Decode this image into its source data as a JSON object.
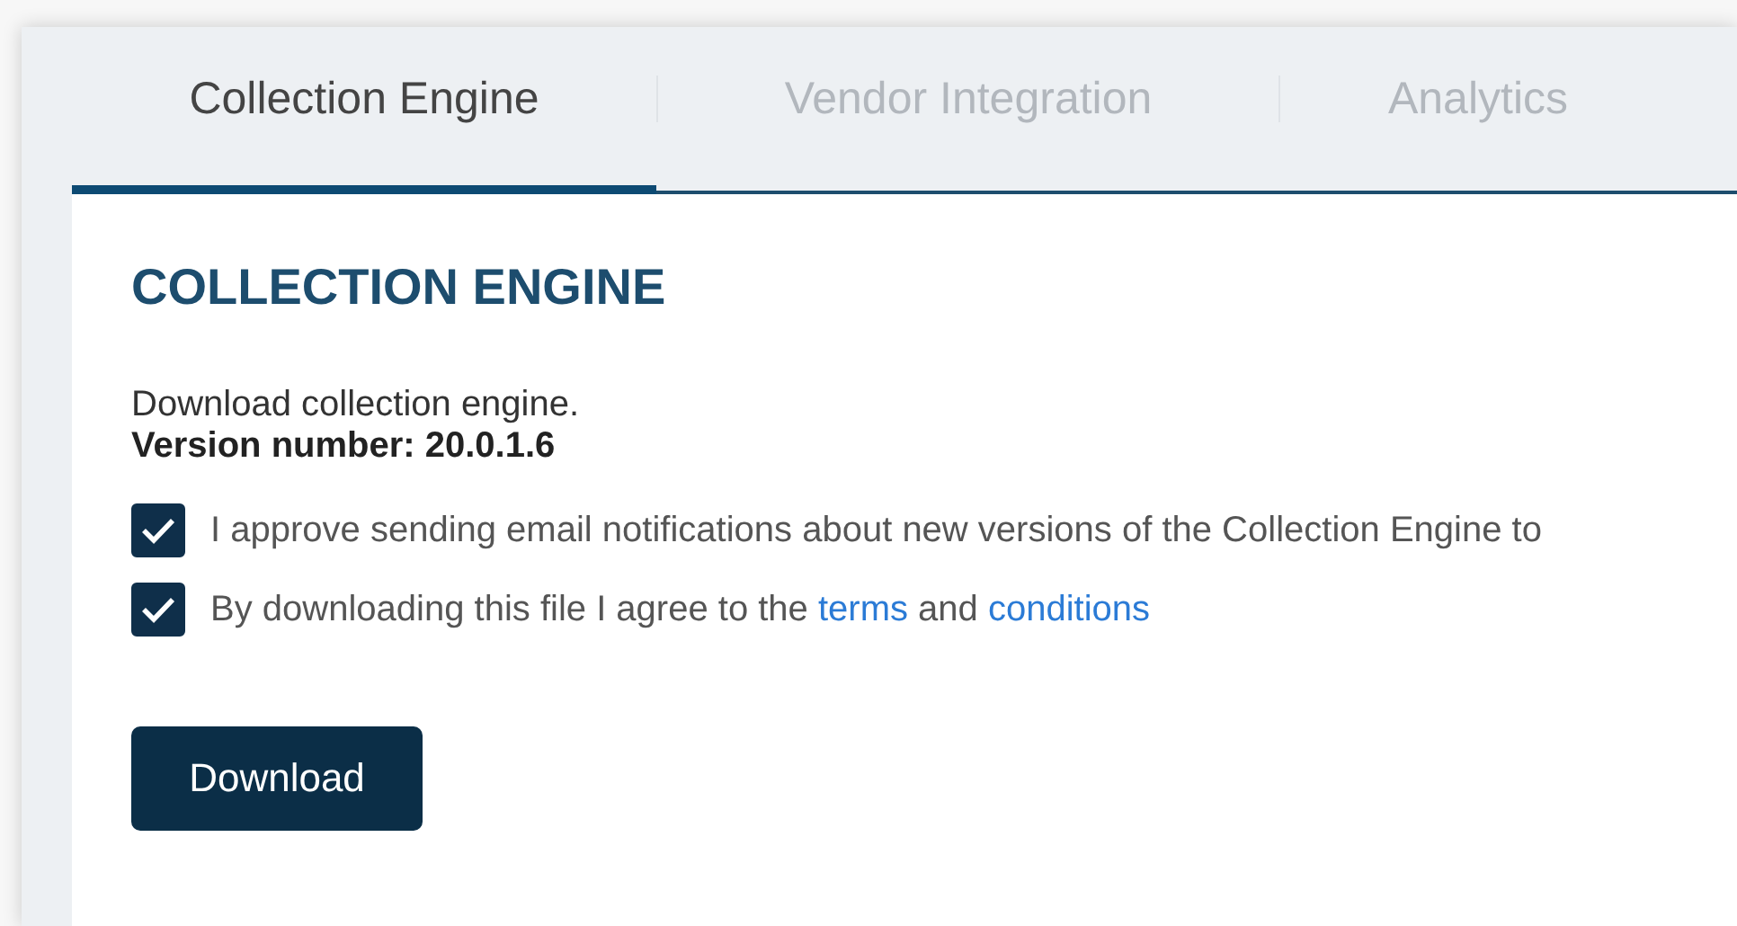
{
  "tabs": [
    {
      "label": "Collection Engine",
      "selected": true
    },
    {
      "label": "Vendor Integration",
      "selected": false
    },
    {
      "label": "Analytics",
      "selected": false
    }
  ],
  "section": {
    "heading": "COLLECTION ENGINE",
    "description": "Download collection engine.",
    "version": "Version number: 20.0.1.6",
    "consents": [
      {
        "checked": true,
        "parts": [
          {
            "kind": "text",
            "text": "I approve sending email notifications about new versions of the Collection Engine to"
          }
        ]
      },
      {
        "checked": true,
        "parts": [
          {
            "kind": "text",
            "text": "By downloading this file I agree to the "
          },
          {
            "kind": "link",
            "text": "terms"
          },
          {
            "kind": "text",
            "text": " and "
          },
          {
            "kind": "link",
            "text": "conditions"
          }
        ]
      }
    ],
    "button": "Download"
  }
}
